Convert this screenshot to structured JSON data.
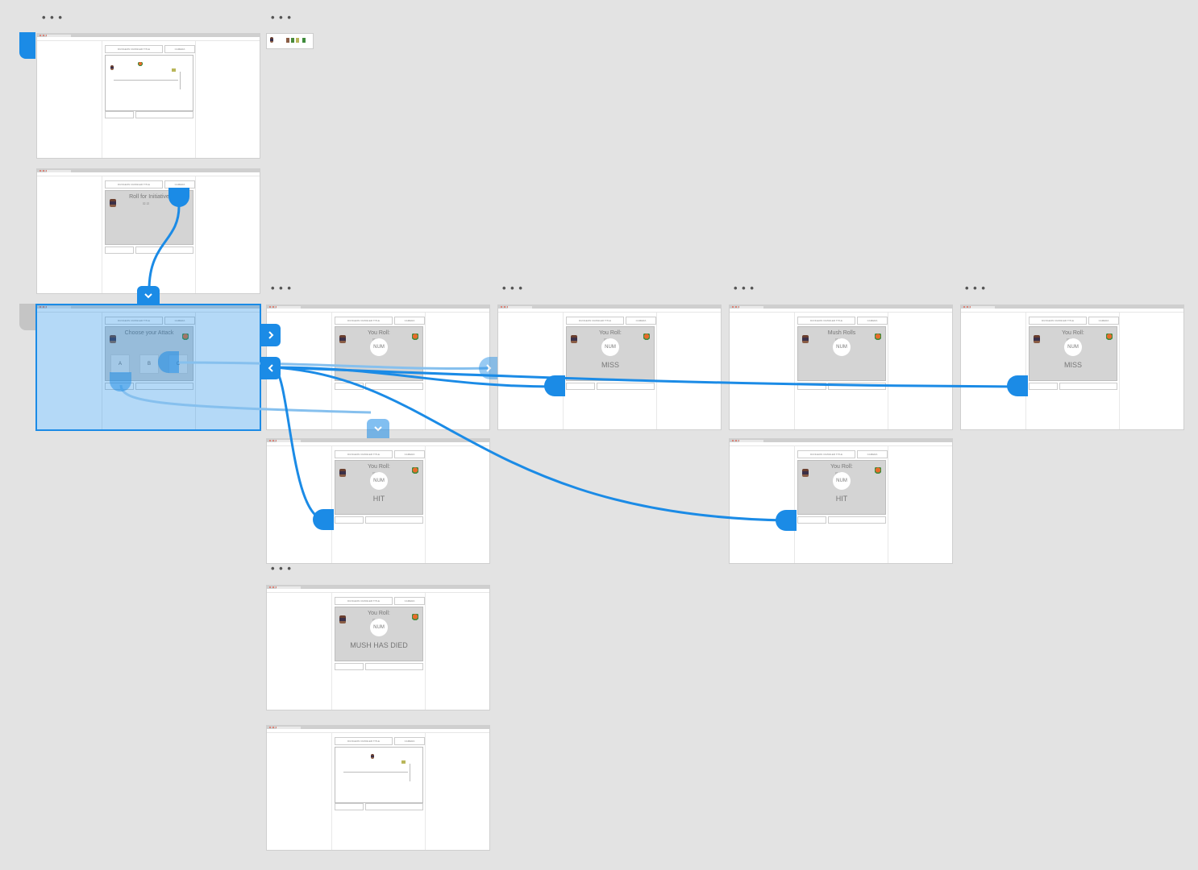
{
  "canvas": {
    "accent_color": "#1b8be6",
    "background_color": "#e3e3e3"
  },
  "header_labels": {
    "game_title_button": "DUNGEON CRAWLER TITLE",
    "camera_button": "CAMERA"
  },
  "palette": {
    "icon_names": [
      "hero-sprite-icon",
      "mush-sprite-icon",
      "tree-icon",
      "goblin-icon",
      "plant-icon"
    ]
  },
  "ellipsis": "• • •",
  "artboards": {
    "start": {
      "name": "map-screen"
    },
    "initiative": {
      "title": "Roll for Initiative",
      "dice": "⚄ ⚂"
    },
    "attack": {
      "title": "Choose your Attack",
      "options": [
        "A",
        "B",
        "C"
      ]
    },
    "roll_miss_1": {
      "title": "You Roll:",
      "num": "NUM",
      "result": "",
      "dice": "⚄ ⚂"
    },
    "roll_miss_2": {
      "title": "You Roll:",
      "num": "NUM",
      "result": "MISS",
      "dice": "⚄ ⚂"
    },
    "mush_roll": {
      "title": "Mush Rolls",
      "num": "NUM",
      "result": "",
      "dice": "⚄ ⚂"
    },
    "roll_miss_3": {
      "title": "You Roll:",
      "num": "NUM",
      "result": "MISS",
      "dice": "⚄ ⚂"
    },
    "roll_hit_1": {
      "title": "You Roll:",
      "num": "NUM",
      "result": "HIT",
      "dice": "⚄ ⚂"
    },
    "roll_hit_2": {
      "title": "You Roll:",
      "num": "NUM",
      "result": "HIT",
      "dice": "⚄ ⚂"
    },
    "mush_died": {
      "title": "You Roll:",
      "num": "NUM",
      "result": "MUSH HAS DIED",
      "dice": "⚄ ⚂"
    },
    "end_map": {
      "name": "map-screen-after"
    }
  }
}
